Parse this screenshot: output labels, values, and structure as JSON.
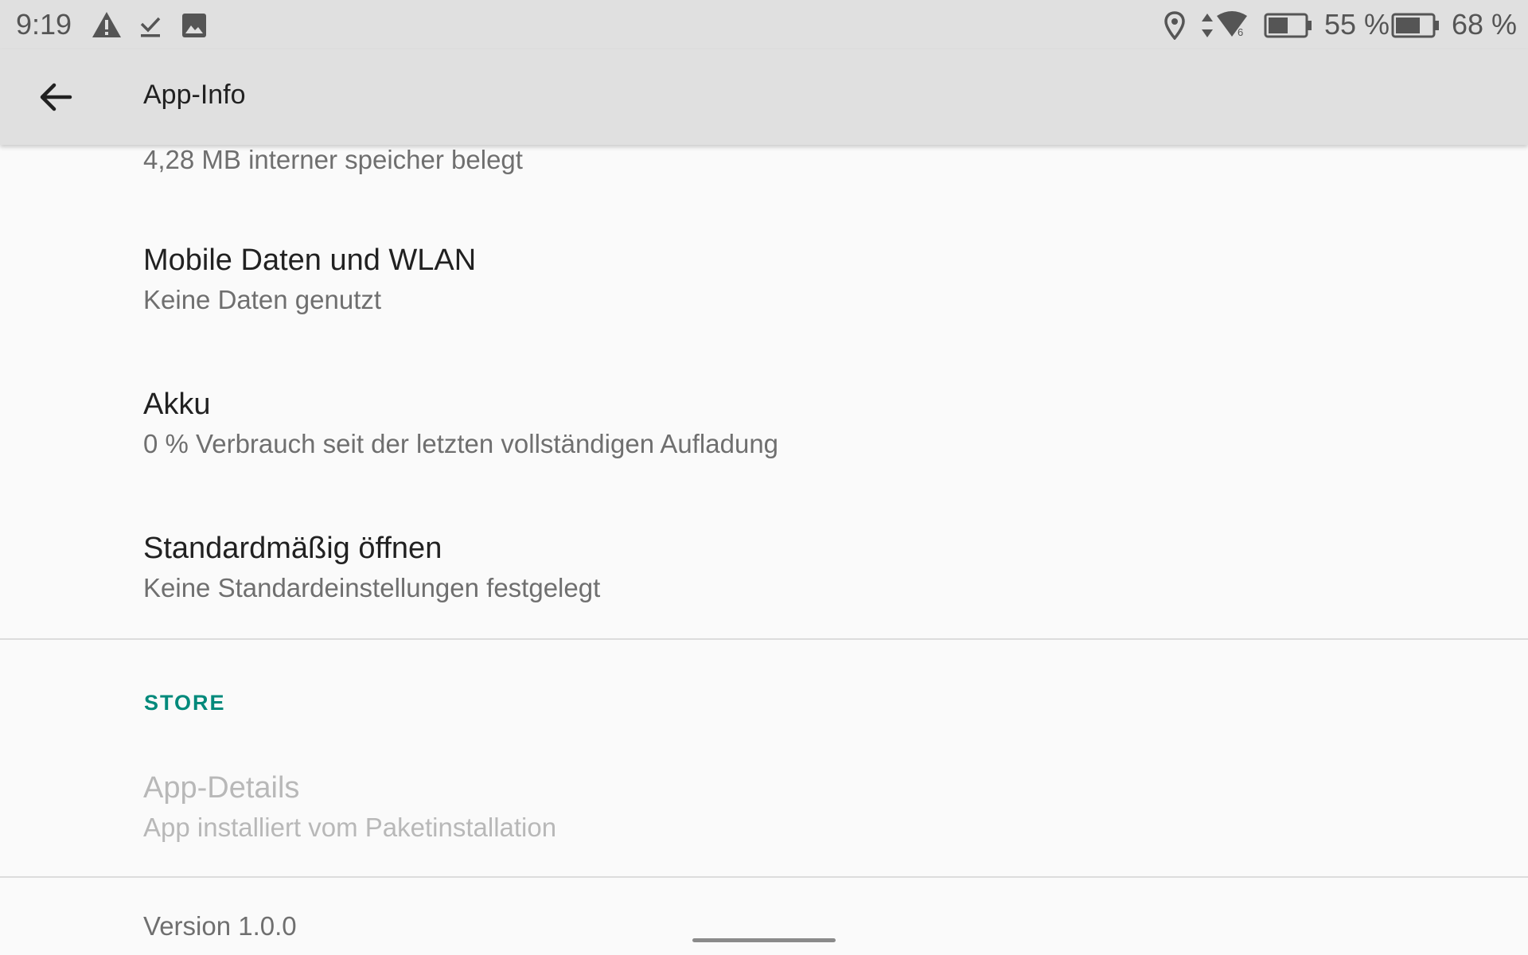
{
  "status_bar": {
    "time": "9:19",
    "battery_1_text": "55 %",
    "battery_2_text": "68 %",
    "icons": [
      "warning-icon",
      "checkmark-icon",
      "image-icon",
      "location-icon",
      "data-arrows-icon",
      "wifi-icon",
      "battery-icon",
      "battery-icon"
    ]
  },
  "toolbar": {
    "title": "App-Info",
    "back_icon": "arrow-back-icon"
  },
  "storage": {
    "summary": "4,28 MB interner speicher belegt"
  },
  "items": [
    {
      "title": "Mobile Daten und WLAN",
      "summary": "Keine Daten genutzt"
    },
    {
      "title": "Akku",
      "summary": "0 % Verbrauch seit der letzten vollständigen Aufladung"
    },
    {
      "title": "Standardmäßig öffnen",
      "summary": "Keine Standardeinstellungen festgelegt"
    }
  ],
  "store_section": {
    "header": "STORE",
    "item": {
      "title": "App-Details",
      "summary": "App installiert vom Paketinstallation"
    }
  },
  "version": "Version 1.0.0",
  "colors": {
    "accent": "#00897b",
    "toolbar_bg": "#e0e0e0",
    "page_bg": "#fafafa",
    "disabled_text": "#b8b8b8"
  }
}
